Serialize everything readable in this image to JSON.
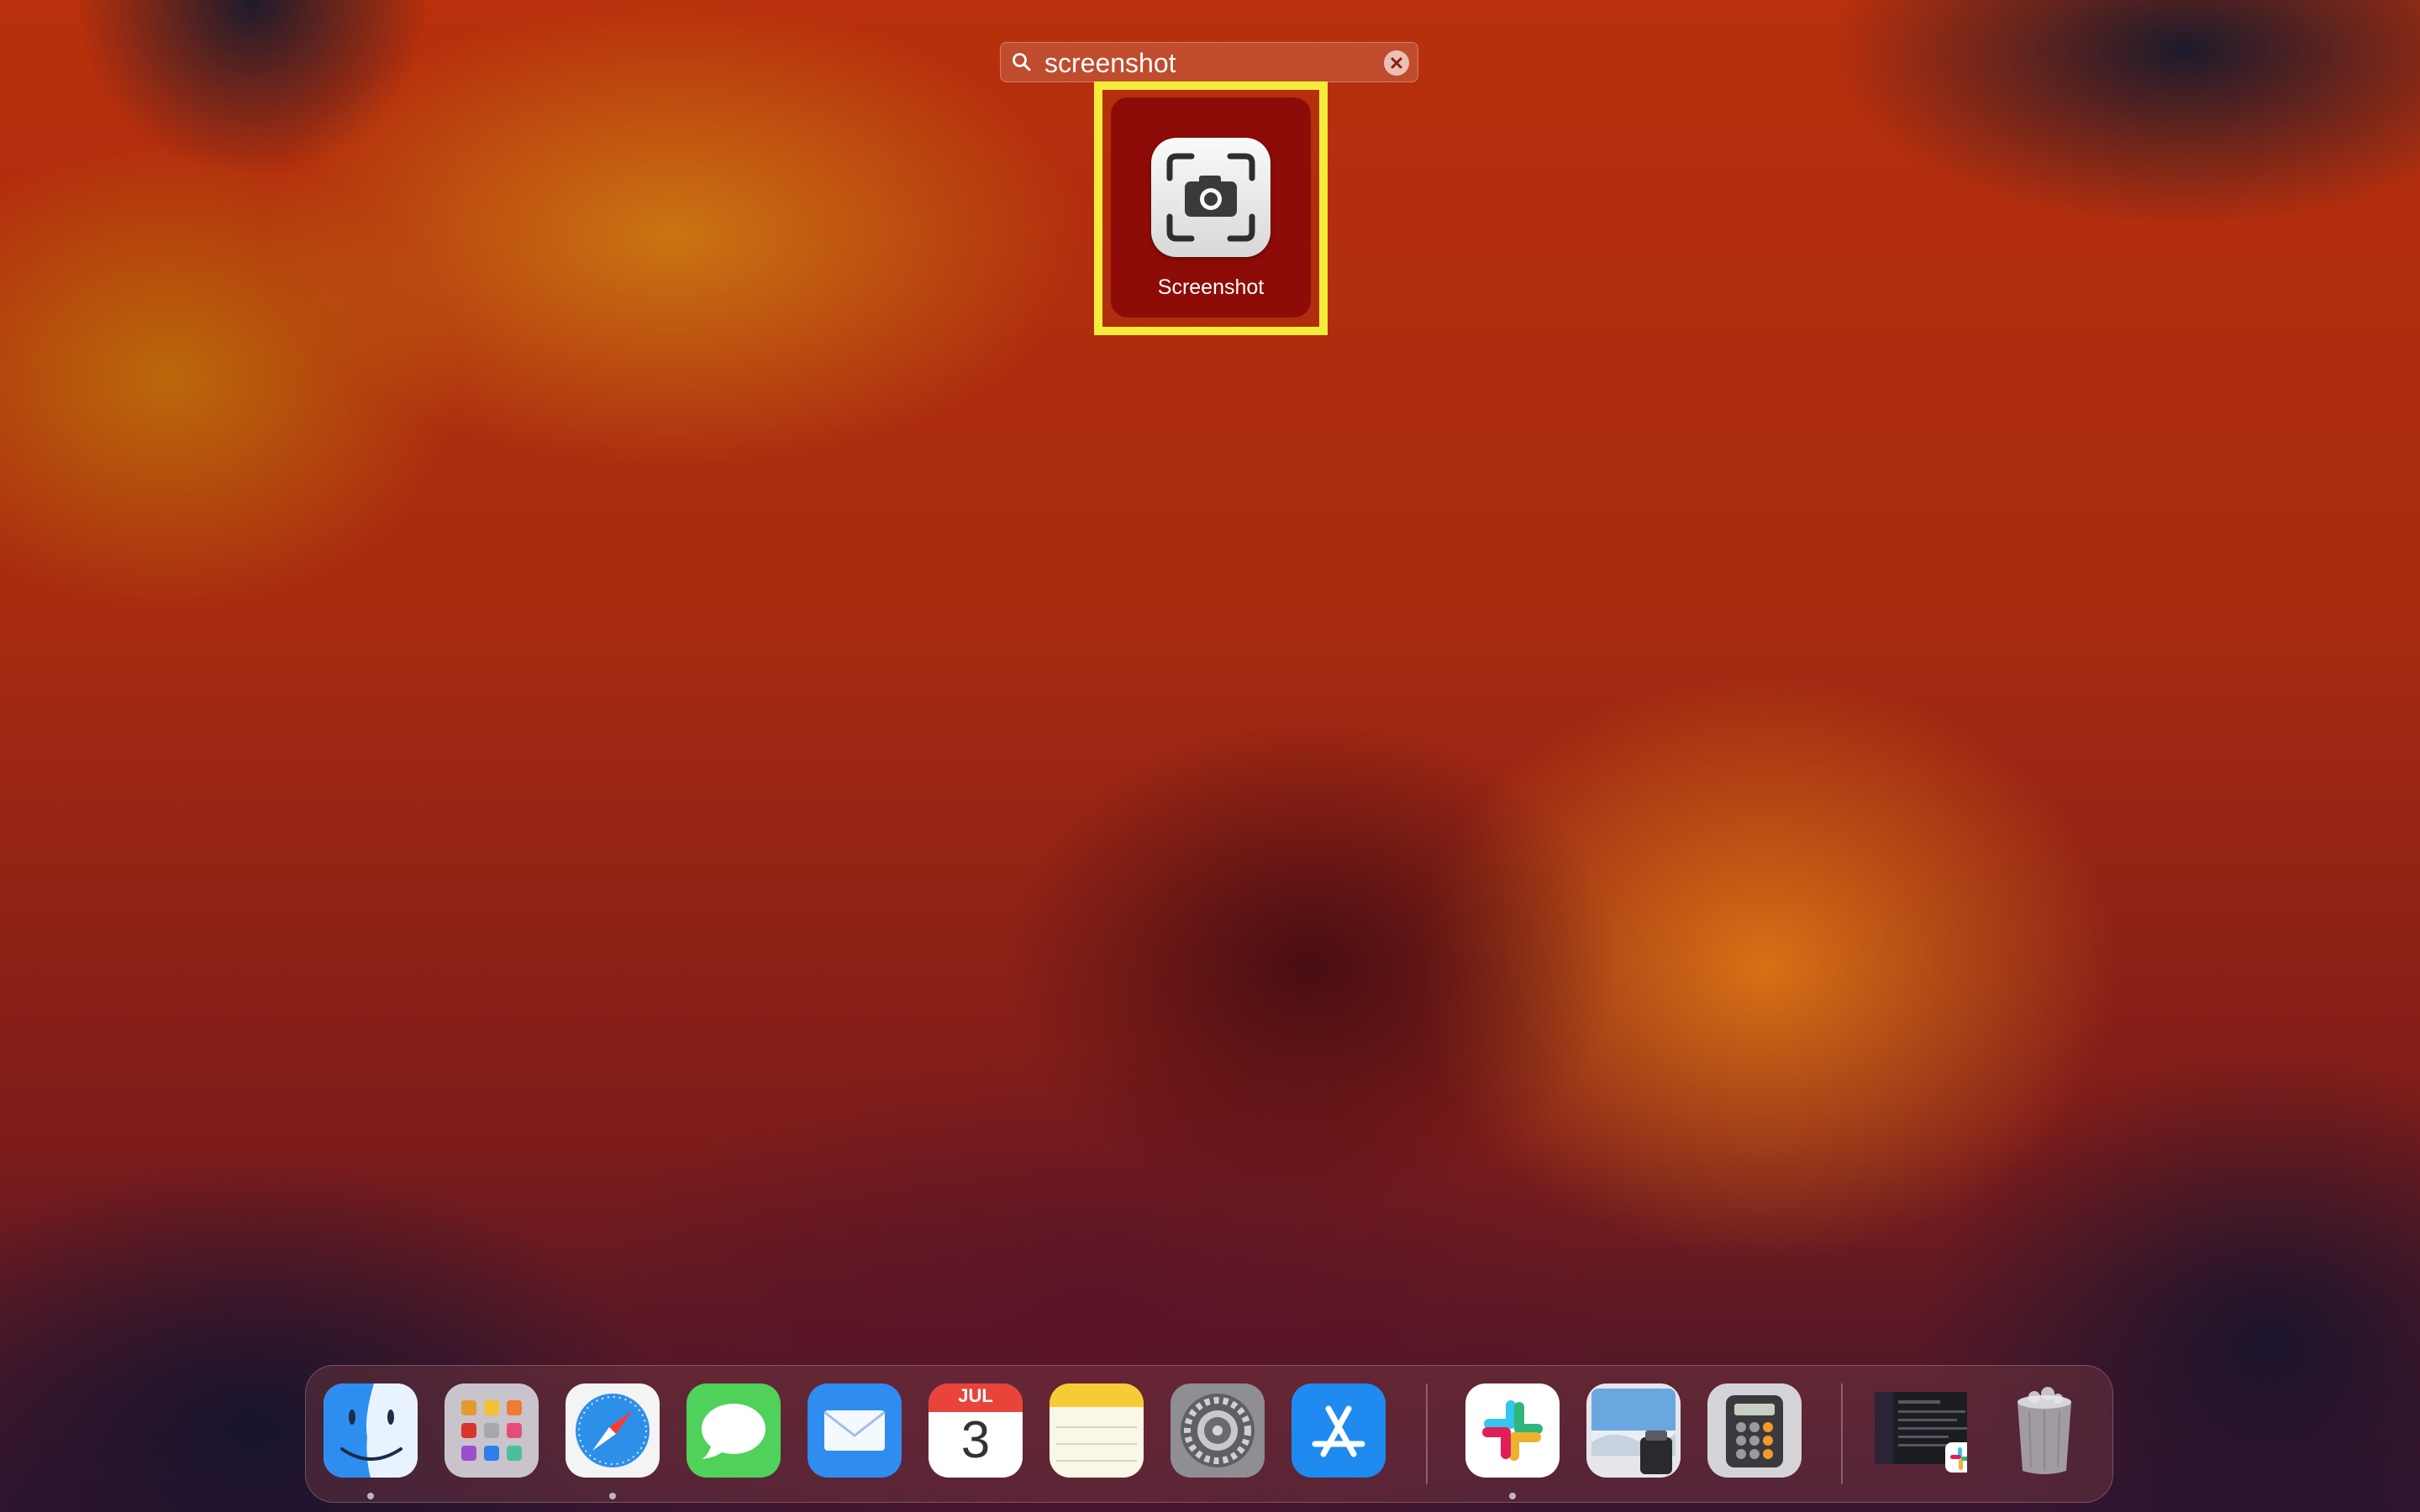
{
  "search": {
    "query": "screenshot"
  },
  "result": {
    "label": "Screenshot",
    "icon": "screenshot-camera-icon"
  },
  "dock": {
    "items": [
      {
        "name": "Finder",
        "icon": "finder-icon",
        "running": true
      },
      {
        "name": "Launchpad",
        "icon": "launchpad-icon",
        "running": false
      },
      {
        "name": "Safari",
        "icon": "safari-icon",
        "running": true
      },
      {
        "name": "Messages",
        "icon": "messages-icon",
        "running": false
      },
      {
        "name": "Mail",
        "icon": "mail-icon",
        "running": false
      },
      {
        "name": "Calendar",
        "icon": "calendar-icon",
        "running": false
      },
      {
        "name": "Notes",
        "icon": "notes-icon",
        "running": false
      },
      {
        "name": "System Settings",
        "icon": "settings-gear-icon",
        "running": false
      },
      {
        "name": "App Store",
        "icon": "app-store-icon",
        "running": false
      },
      {
        "name": "Slack",
        "icon": "slack-icon",
        "running": true
      },
      {
        "name": "Preview",
        "icon": "preview-icon",
        "running": false
      },
      {
        "name": "Calculator",
        "icon": "calculator-icon",
        "running": false
      },
      {
        "name": "Slack window",
        "icon": "minimized-window-icon",
        "running": false
      },
      {
        "name": "Trash",
        "icon": "trash-icon",
        "running": false
      }
    ],
    "calendar": {
      "month": "JUL",
      "day": "3"
    }
  },
  "colors": {
    "highlight": "#f5ec3a",
    "result_tile": "#8e0c07"
  }
}
